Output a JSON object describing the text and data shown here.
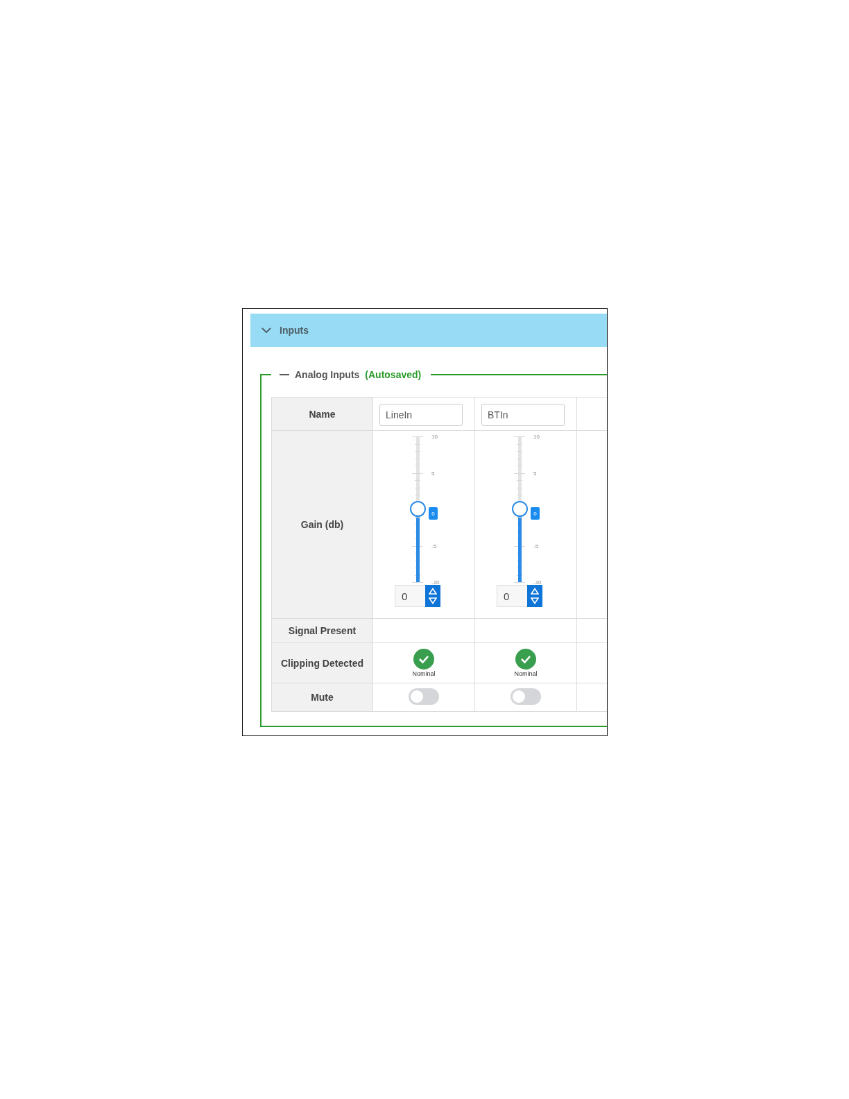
{
  "panel": {
    "title": "Inputs",
    "expanded": true
  },
  "group": {
    "title": "Analog Inputs",
    "status": "(Autosaved)",
    "expanded": true
  },
  "row_labels": [
    "Name",
    "Gain (db)",
    "Signal Present",
    "Clipping Detected",
    "Mute"
  ],
  "channels": [
    {
      "name": "LineIn",
      "gain": {
        "level": 0.5,
        "tooltip": "0",
        "value": "0",
        "scale": [
          "10",
          "5",
          "-5",
          "-10"
        ]
      },
      "clipping": {
        "ok": true,
        "label": "Nominal"
      },
      "mute": {
        "on": false
      }
    },
    {
      "name": "BTIn",
      "gain": {
        "level": 0.5,
        "tooltip": "0",
        "value": "0",
        "scale": [
          "10",
          "5",
          "-5",
          "-10"
        ]
      },
      "clipping": {
        "ok": true,
        "label": "Nominal"
      },
      "mute": {
        "on": false
      }
    }
  ]
}
